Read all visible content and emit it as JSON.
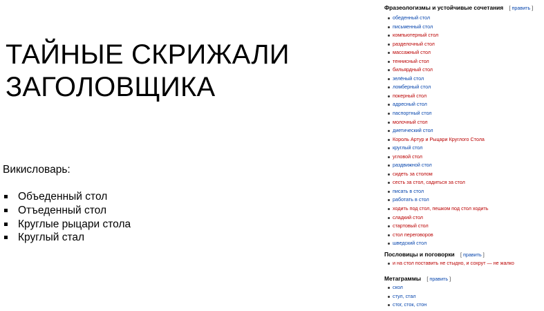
{
  "title": {
    "line1": "ТАЙНЫЕ СКРИЖАЛИ",
    "line2": "ЗАГОЛОВЩИКА"
  },
  "source_label": "Викисловарь:",
  "bullets": [
    "Объеденный стол",
    "Отъеденный стол",
    "Круглые рыцари стола",
    "Круглый стал"
  ],
  "wiki": {
    "edit_label": "править",
    "sections": [
      {
        "heading": "Фразеологизмы и устойчивые сочетания",
        "items": [
          {
            "text": "обеденный стол",
            "color": "blue"
          },
          {
            "text": "письменный стол",
            "color": "blue"
          },
          {
            "text": "компьютерный стол",
            "color": "red"
          },
          {
            "text": "разделочный стол",
            "color": "red"
          },
          {
            "text": "массажный стол",
            "color": "red"
          },
          {
            "text": "теннисный стол",
            "color": "red"
          },
          {
            "text": "бильярдный стол",
            "color": "red"
          },
          {
            "text": "зелёный стол",
            "color": "blue"
          },
          {
            "text": "ломберный стол",
            "color": "blue"
          },
          {
            "text": "покерный стол",
            "color": "red"
          },
          {
            "text": "адресный стол",
            "color": "blue"
          },
          {
            "text": "паспортный стол",
            "color": "blue"
          },
          {
            "text": "молочный стол",
            "color": "red"
          },
          {
            "text": "диетический стол",
            "color": "blue"
          },
          {
            "text": "Король Артур и Рыцари Круглого Стола",
            "color": "red"
          },
          {
            "text": "круглый стол",
            "color": "blue"
          },
          {
            "text": "угловой стол",
            "color": "red"
          },
          {
            "text": "раздвижной стол",
            "color": "blue"
          },
          {
            "text": "сидеть за столом",
            "color": "red"
          },
          {
            "text": "сесть за стол, садиться за стол",
            "color": "red"
          },
          {
            "text": "писать в стол",
            "color": "blue"
          },
          {
            "text": "работать в стол",
            "color": "blue"
          },
          {
            "text": "ходить под стол, пешком под стол ходить",
            "color": "red"
          },
          {
            "text": "сладкий стол",
            "color": "red"
          },
          {
            "text": "стартовый стол",
            "color": "red"
          },
          {
            "text": "стол переговоров",
            "color": "red"
          },
          {
            "text": "шведский стол",
            "color": "blue"
          }
        ]
      },
      {
        "heading": "Пословицы и поговорки",
        "items": [
          {
            "text": "и на стол поставить не стыдно, и сохрут — не жалко",
            "color": "red"
          }
        ]
      },
      {
        "heading": "Метаграммы",
        "items": [
          {
            "text": "скол",
            "color": "blue"
          },
          {
            "text": "стул, стал",
            "color": "blue"
          },
          {
            "text": "стог, сток, стон",
            "color": "blue"
          }
        ]
      }
    ]
  }
}
